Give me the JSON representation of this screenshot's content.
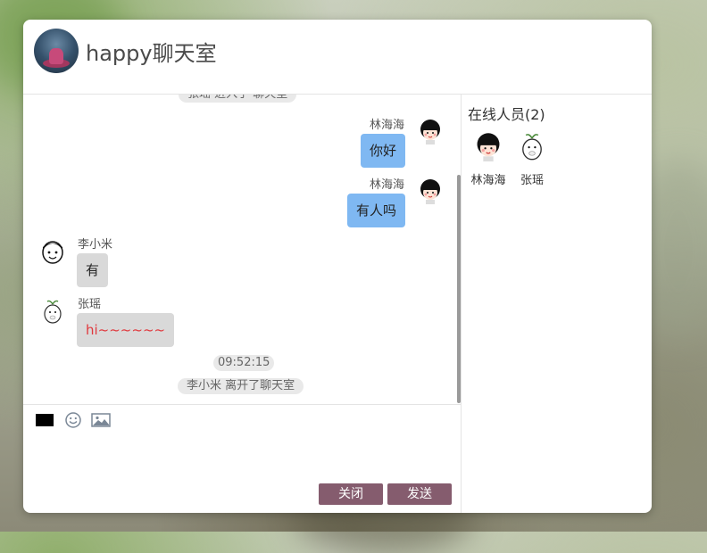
{
  "room": {
    "title": "happy聊天室",
    "avatar_icon": "room-avatar-photo"
  },
  "messages": [
    {
      "kind": "system",
      "text": "张瑶 进入了 聊天室"
    },
    {
      "kind": "chat",
      "side": "right",
      "sender": "林海海",
      "text": "你好",
      "avatar": "chibi-girl-avatar"
    },
    {
      "kind": "chat",
      "side": "right",
      "sender": "林海海",
      "text": "有人吗",
      "avatar": "chibi-girl-avatar"
    },
    {
      "kind": "chat",
      "side": "left",
      "sender": "李小米",
      "text": "有",
      "avatar": "chibi-boy-avatar"
    },
    {
      "kind": "chat",
      "side": "left",
      "sender": "张瑶",
      "text": "hi~~~~~~",
      "avatar": "sprout-creature-avatar"
    },
    {
      "kind": "time",
      "text": "09:52:15"
    },
    {
      "kind": "system",
      "text": "李小米 离开了聊天室"
    }
  ],
  "composer": {
    "color_swatch": "#000000",
    "emoji_icon": "smiley-icon",
    "image_icon": "image-icon",
    "input_value": "",
    "close_label": "关闭",
    "send_label": "发送"
  },
  "online": {
    "title": "在线人员(2)",
    "users": [
      {
        "name": "林海海",
        "avatar": "chibi-girl-avatar"
      },
      {
        "name": "张瑶",
        "avatar": "sprout-creature-avatar"
      }
    ]
  },
  "colors": {
    "mine_bubble": "#7fb8f2",
    "other_bubble": "#d9d9d9",
    "button": "#855c6e",
    "red_text": "#e0393e"
  }
}
